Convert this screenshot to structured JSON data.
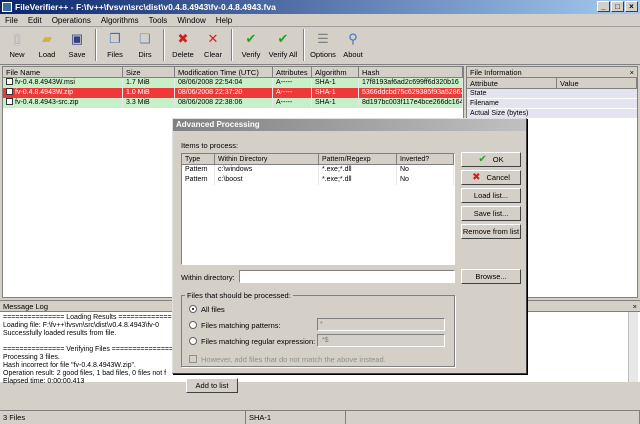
{
  "window": {
    "title": "FileVerifier++ - F:\\fv++\\fvsvn\\src\\dist\\v0.4.8.4943\\fv-0.4.8.4943.fva",
    "min": "_",
    "max": "□",
    "close": "×"
  },
  "menu": [
    "File",
    "Edit",
    "Operations",
    "Algorithms",
    "Tools",
    "Window",
    "Help"
  ],
  "toolbar": [
    {
      "label": "New",
      "icon": "new-file-icon"
    },
    {
      "label": "Load",
      "icon": "open-folder-icon"
    },
    {
      "label": "Save",
      "icon": "floppy-disk-icon"
    },
    {
      "label": "Files",
      "icon": "files-icon"
    },
    {
      "label": "Dirs",
      "icon": "folders-icon"
    },
    {
      "label": "Delete",
      "icon": "delete-icon"
    },
    {
      "label": "Clear",
      "icon": "clear-icon"
    },
    {
      "label": "Verify",
      "icon": "verify-icon"
    },
    {
      "label": "Verify All",
      "icon": "verify-all-icon"
    },
    {
      "label": "Options",
      "icon": "options-icon"
    },
    {
      "label": "About",
      "icon": "about-icon"
    }
  ],
  "grid": {
    "columns": [
      "File Name",
      "Size",
      "Modification Time (UTC)",
      "Attributes",
      "Algorithm",
      "Hash"
    ],
    "rows": [
      {
        "name": "fv-0.4.8.4943W.msi",
        "size": "1.7 MiB",
        "mtime": "08/06/2008 22:54:04",
        "attr": "A-----",
        "algo": "SHA-1",
        "hash": "17f8193af6ad2c699ff6d320b16",
        "state": "ok"
      },
      {
        "name": "fv-0.4.8.4943W.zip",
        "size": "1.0 MiB",
        "mtime": "08/06/2008 22:37:20",
        "attr": "A-----",
        "algo": "SHA-1",
        "hash": "5366ddcbd75c629385f93a52862",
        "state": "bad"
      },
      {
        "name": "fv-0.4.8.4943-src.zip",
        "size": "3.3 MiB",
        "mtime": "08/06/2008 22:38:06",
        "attr": "A-----",
        "algo": "SHA-1",
        "hash": "8d197bc003f117e4bce266dc164",
        "state": "ok"
      }
    ]
  },
  "fileinfo": {
    "title": "File Information",
    "close": "×",
    "columns": [
      "Attribute",
      "Value"
    ],
    "rows": [
      "State",
      "Filename",
      "Actual Size (bytes)"
    ]
  },
  "msglog": {
    "title": "Message Log",
    "close": "×",
    "lines": [
      "=============== Loading Results ===============",
      "Loading file: F:\\fv++\\fvsvn\\src\\dist\\v0.4.8.4943\\fv-0",
      "Successfully loaded results from file.",
      "",
      "=============== Verifying Files ===============",
      "Processing 3 files.",
      "Hash incorrect for file \"fv-0.4.8.4943W.zip\".",
      "Operation result: 2 good files, 1 bad files, 0 files not f",
      "Elapsed time: 0:00:00.413"
    ]
  },
  "status": {
    "files": "3 Files",
    "algo": "SHA-1"
  },
  "dialog": {
    "title": "Advanced Processing",
    "items_label": "Items to process:",
    "columns": [
      "Type",
      "Within Directory",
      "Pattern/Regexp",
      "Inverted?"
    ],
    "rows": [
      {
        "type": "Pattern",
        "dir": "c:\\windows",
        "pattern": "*.exe;*.dll",
        "inv": "No"
      },
      {
        "type": "Pattern",
        "dir": "c:\\boost",
        "pattern": "*.exe;*.dll",
        "inv": "No"
      }
    ],
    "ok": "OK",
    "cancel": "Cancel",
    "load": "Load list...",
    "save": "Save list...",
    "remove": "Remove from list",
    "within_label": "Within directory:",
    "within_value": "",
    "browse": "Browse...",
    "group_label": "Files that should be processed:",
    "opt_all": "All files",
    "opt_pattern": "Files matching patterns:",
    "pattern_value": "*",
    "opt_regex": "Files matching regular expression:",
    "regex_value": ".*$",
    "invert_label": "However, add files that do not match the above instead.",
    "add": "Add to list"
  }
}
